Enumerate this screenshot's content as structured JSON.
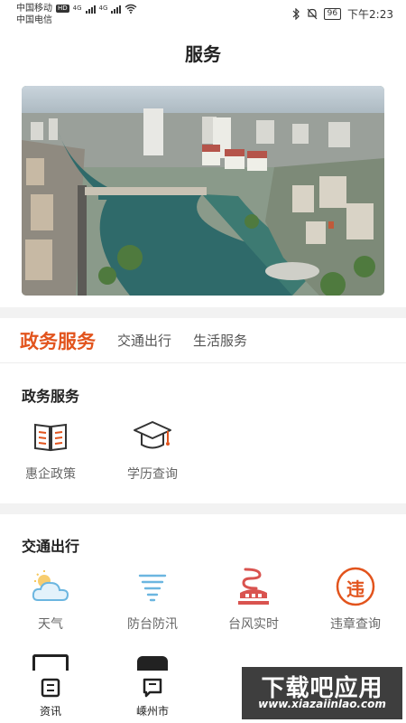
{
  "status_bar": {
    "carrier1": "中国移动",
    "hd": "HD",
    "net1": "4G",
    "net2": "4G",
    "carrier2": "中国电信",
    "battery": "96",
    "time": "下午2:23"
  },
  "header": {
    "title": "服务"
  },
  "tabs": [
    {
      "label": "政务服务",
      "active": true
    },
    {
      "label": "交通出行",
      "active": false
    },
    {
      "label": "生活服务",
      "active": false
    }
  ],
  "sections": {
    "government": {
      "title": "政务服务",
      "items": [
        {
          "label": "惠企政策",
          "icon": "policy-book-icon"
        },
        {
          "label": "学历查询",
          "icon": "graduation-cap-icon"
        }
      ]
    },
    "traffic": {
      "title": "交通出行",
      "items": [
        {
          "label": "天气",
          "icon": "weather-cloud-icon"
        },
        {
          "label": "防台防汛",
          "icon": "tornado-icon"
        },
        {
          "label": "台风实时",
          "icon": "typhoon-icon"
        },
        {
          "label": "违章查询",
          "icon": "violation-badge-icon"
        }
      ],
      "violation_badge_char": "违"
    }
  },
  "bottom_nav": [
    {
      "label": "资讯",
      "icon": "news-icon"
    },
    {
      "label": "嵊州市",
      "icon": "city-icon"
    }
  ],
  "watermark": {
    "text": "下载吧应用",
    "url": "www.xiazaiinlao.com"
  },
  "colors": {
    "accent": "#e2541d",
    "weather_blue": "#6bb6e0",
    "typhoon_red": "#d9534f"
  }
}
